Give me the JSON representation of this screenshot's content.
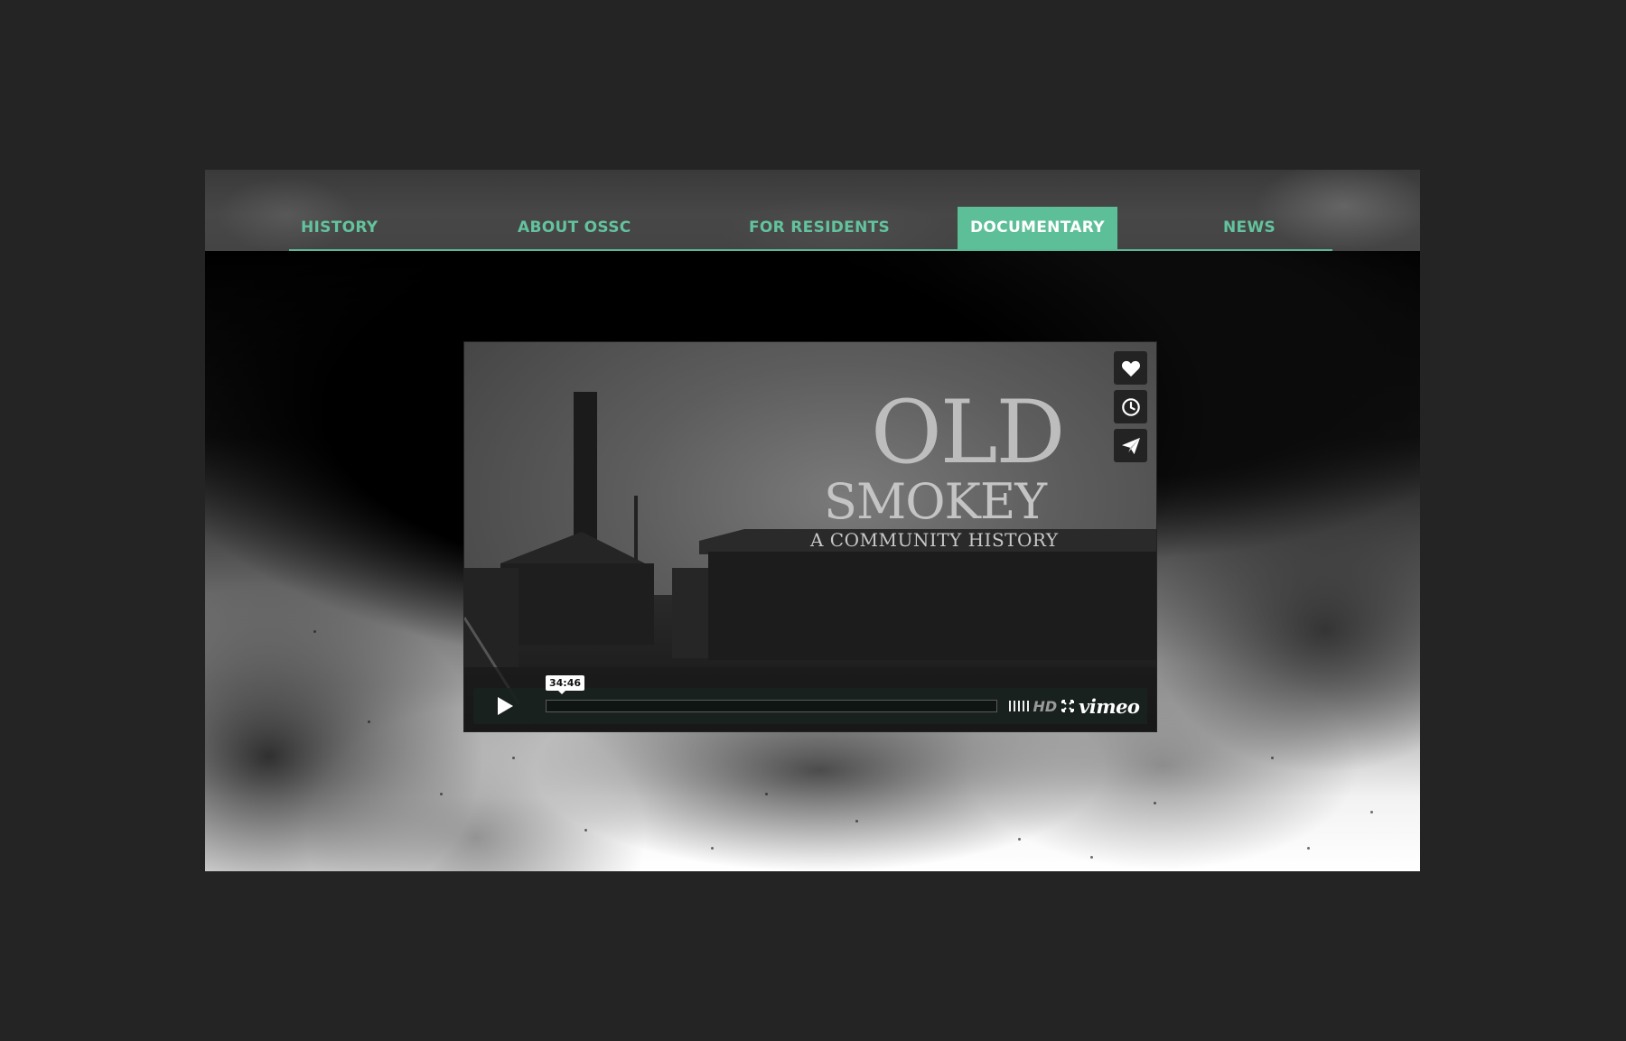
{
  "nav": {
    "items": [
      {
        "label": "HISTORY",
        "active": false
      },
      {
        "label": "ABOUT OSSC",
        "active": false
      },
      {
        "label": "FOR RESIDENTS",
        "active": false
      },
      {
        "label": "DOCUMENTARY",
        "active": true
      },
      {
        "label": "NEWS",
        "active": false
      }
    ],
    "accent_color": "#5dbf98"
  },
  "video": {
    "title_line1": "OLD",
    "title_line2": "SMOKEY",
    "title_line3": "A COMMUNITY HISTORY",
    "duration": "34:46",
    "hd_label": "HD",
    "brand": "vimeo",
    "side_buttons": [
      "heart-icon",
      "clock-icon",
      "send-icon"
    ]
  }
}
